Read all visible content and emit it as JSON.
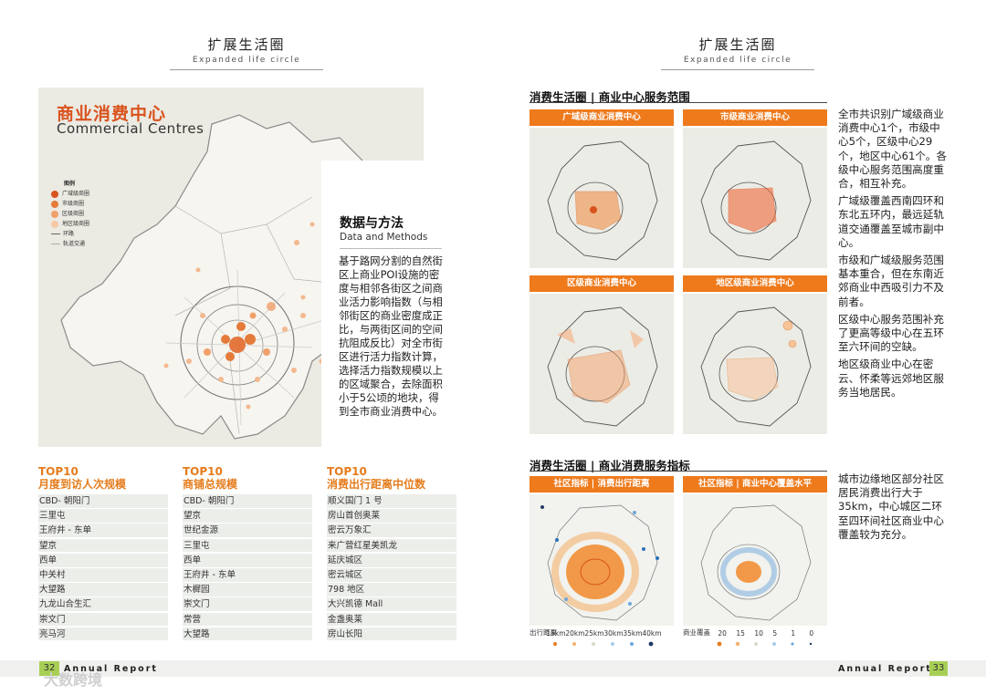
{
  "left_page": {
    "header_cn": "扩展生活圈",
    "header_en": "Expanded life circle",
    "map": {
      "title_cn": "商业消费中心",
      "title_en": "Commercial Centres",
      "legend_title": "图例",
      "legend": [
        "广域级商圈",
        "市级商圈",
        "区级商圈",
        "地区级商圈",
        "环路",
        "轨道交通"
      ]
    },
    "method": {
      "title": "数据与方法",
      "subtitle": "Data and Methods",
      "body": "基于路网分割的自然街区上商业POI设施的密度与相邻各街区之间商业活力影响指数（与相邻街区的商业密度成正比，与两街区间的空间抗阻成反比）对全市街区进行活力指数计算，选择活力指数规模以上的区域聚合，去除面积小于5公顷的地块，得到全市商业消费中心。"
    },
    "top10": [
      {
        "label": "TOP10",
        "title": "月度到访人次规模",
        "items": [
          "CBD- 朝阳门",
          "三里屯",
          "王府井 - 东单",
          "望京",
          "西单",
          "中关村",
          "大望路",
          "九龙山合生汇",
          "崇文门",
          "亮马河"
        ]
      },
      {
        "label": "TOP10",
        "title": "商铺总规模",
        "items": [
          "CBD- 朝阳门",
          "望京",
          "世纪金源",
          "三里屯",
          "西单",
          "王府井 - 东单",
          "木樨园",
          "崇文门",
          "常营",
          "大望路"
        ]
      },
      {
        "label": "TOP10",
        "title": "消费出行距离中位数",
        "items": [
          "顺义国门 1 号",
          "房山首创奥莱",
          "密云万象汇",
          "来广营红星美凯龙",
          "延庆城区",
          "密云城区",
          "798 地区",
          "大兴凯德 Mall",
          "金盏奥莱",
          "房山长阳"
        ]
      }
    ],
    "page_number": "32",
    "footer": "Annual Report",
    "watermark": "大数跨境"
  },
  "right_page": {
    "header_cn": "扩展生活圈",
    "header_en": "Expanded life circle",
    "section1": {
      "title": "消费生活圈 | 商业中心服务范围",
      "panels": [
        "广域级商业消费中心",
        "市级商业消费中心",
        "区级商业消费中心",
        "地区级商业消费中心"
      ],
      "paragraphs": [
        "全市共识别广域级商业消费中心1个，市级中心5个，区级中心29个，地区中心61个。各级中心服务范围高度重合，相互补充。",
        "广域级覆盖西南四环和东北五环内，最远延轨道交通覆盖至城市副中心。",
        "市级和广域级服务范围基本重合，但在东南近郊商业中西吸引力不及前者。",
        "区级中心服务范围补充了更高等级中心在五环至六环间的空缺。",
        "地区级商业中心在密云、怀柔等远郊地区服务当地居民。"
      ]
    },
    "section2": {
      "title": "消费生活圈 | 商业消费服务指标",
      "panels": [
        "社区指标 | 消费出行距离",
        "社区指标 | 商业中心覆盖水平"
      ],
      "paragraph": "城市边缘地区部分社区居民消费出行大于35km，中心城区二环至四环间社区商业中心覆盖较为充分。",
      "legend1_label": "出行距离",
      "legend1_values": [
        "15km",
        "20km",
        "25km",
        "30km",
        "35km",
        "40km"
      ],
      "legend2_label": "商业覆盖",
      "legend2_values": [
        "20",
        "15",
        "10",
        "5",
        "1",
        "0"
      ]
    },
    "page_number": "33",
    "footer": "Annual Report"
  },
  "colors": {
    "accent_orange": "#ee7a1c",
    "title_orange": "#d9531e",
    "page_green": "#a8cf55"
  }
}
